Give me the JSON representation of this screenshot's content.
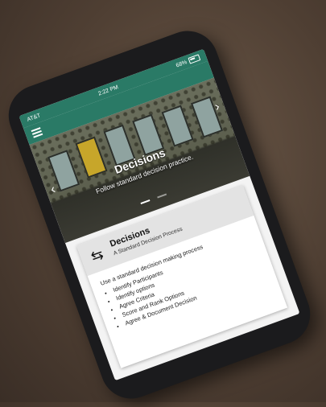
{
  "status": {
    "carrier": "AT&T",
    "time": "2:22 PM",
    "battery": "68%"
  },
  "hero": {
    "title": "Decisions",
    "subtitle": "Follow standard decision practice."
  },
  "card": {
    "title": "Decisions",
    "subtitle": "A Standard Decision Process",
    "intro": "Use a standard decision making process",
    "steps": [
      "Identify Participants",
      "Identify options",
      "Agree Criteria",
      "Score and Rank Options",
      "Agree & Document Decision"
    ]
  },
  "colors": {
    "appbar": "#2a7a66",
    "door_accent": "#c7a62a"
  }
}
